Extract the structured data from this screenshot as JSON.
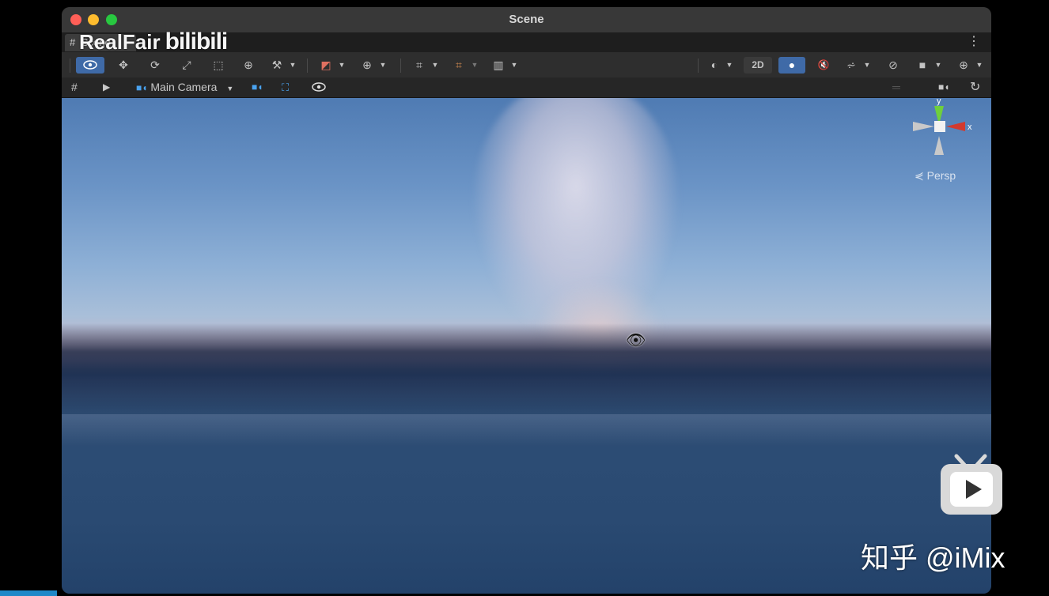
{
  "window": {
    "title": "Scene",
    "traffic_lights": {
      "close": "#ff5f57",
      "minimize": "#febc2e",
      "maximize": "#28c840"
    }
  },
  "tab": {
    "grid_glyph": "#",
    "label": "Scene",
    "menu_icon": "kebab-menu-icon"
  },
  "watermark": {
    "text": "RealFair",
    "logo": "bilibili"
  },
  "toolbar": {
    "tools": [
      "view-tool-icon",
      "move-tool-icon",
      "rotate-tool-icon",
      "scale-tool-icon",
      "rect-tool-icon",
      "transform-tool-icon",
      "custom-tool-icon"
    ],
    "toggle_2d_label": "2D",
    "accent": "#3f6aa7"
  },
  "overlay_bar": {
    "grid_glyph": "#",
    "play_glyph": "▶",
    "camera_label": "Main Camera"
  },
  "viewport": {
    "projection_label": "⋞ Persp",
    "gizmo_labels": {
      "y": "y",
      "x": "x"
    }
  },
  "branding": {
    "zhihu_text": "知乎 @iMix"
  }
}
